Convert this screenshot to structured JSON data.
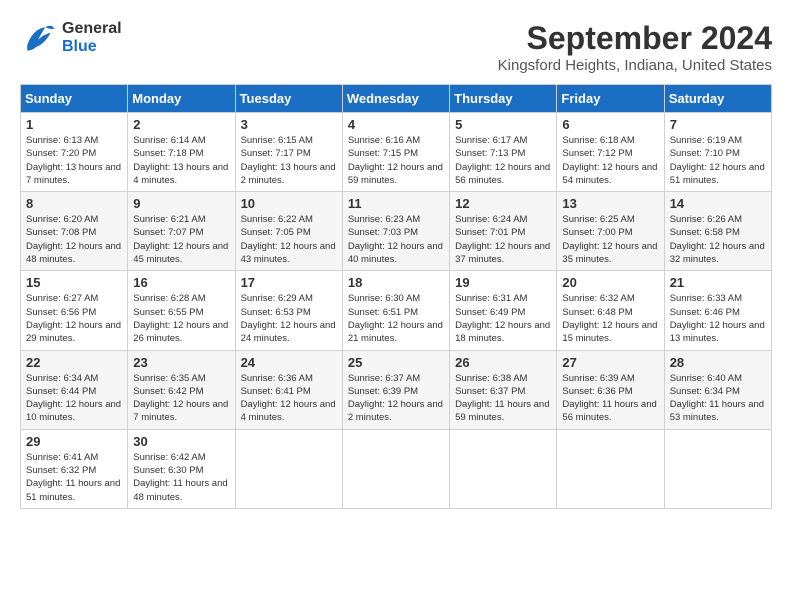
{
  "header": {
    "logo_line1": "General",
    "logo_line2": "Blue",
    "title": "September 2024",
    "subtitle": "Kingsford Heights, Indiana, United States"
  },
  "columns": [
    "Sunday",
    "Monday",
    "Tuesday",
    "Wednesday",
    "Thursday",
    "Friday",
    "Saturday"
  ],
  "weeks": [
    [
      {
        "day": "1",
        "sunrise": "Sunrise: 6:13 AM",
        "sunset": "Sunset: 7:20 PM",
        "daylight": "Daylight: 13 hours and 7 minutes."
      },
      {
        "day": "2",
        "sunrise": "Sunrise: 6:14 AM",
        "sunset": "Sunset: 7:18 PM",
        "daylight": "Daylight: 13 hours and 4 minutes."
      },
      {
        "day": "3",
        "sunrise": "Sunrise: 6:15 AM",
        "sunset": "Sunset: 7:17 PM",
        "daylight": "Daylight: 13 hours and 2 minutes."
      },
      {
        "day": "4",
        "sunrise": "Sunrise: 6:16 AM",
        "sunset": "Sunset: 7:15 PM",
        "daylight": "Daylight: 12 hours and 59 minutes."
      },
      {
        "day": "5",
        "sunrise": "Sunrise: 6:17 AM",
        "sunset": "Sunset: 7:13 PM",
        "daylight": "Daylight: 12 hours and 56 minutes."
      },
      {
        "day": "6",
        "sunrise": "Sunrise: 6:18 AM",
        "sunset": "Sunset: 7:12 PM",
        "daylight": "Daylight: 12 hours and 54 minutes."
      },
      {
        "day": "7",
        "sunrise": "Sunrise: 6:19 AM",
        "sunset": "Sunset: 7:10 PM",
        "daylight": "Daylight: 12 hours and 51 minutes."
      }
    ],
    [
      {
        "day": "8",
        "sunrise": "Sunrise: 6:20 AM",
        "sunset": "Sunset: 7:08 PM",
        "daylight": "Daylight: 12 hours and 48 minutes."
      },
      {
        "day": "9",
        "sunrise": "Sunrise: 6:21 AM",
        "sunset": "Sunset: 7:07 PM",
        "daylight": "Daylight: 12 hours and 45 minutes."
      },
      {
        "day": "10",
        "sunrise": "Sunrise: 6:22 AM",
        "sunset": "Sunset: 7:05 PM",
        "daylight": "Daylight: 12 hours and 43 minutes."
      },
      {
        "day": "11",
        "sunrise": "Sunrise: 6:23 AM",
        "sunset": "Sunset: 7:03 PM",
        "daylight": "Daylight: 12 hours and 40 minutes."
      },
      {
        "day": "12",
        "sunrise": "Sunrise: 6:24 AM",
        "sunset": "Sunset: 7:01 PM",
        "daylight": "Daylight: 12 hours and 37 minutes."
      },
      {
        "day": "13",
        "sunrise": "Sunrise: 6:25 AM",
        "sunset": "Sunset: 7:00 PM",
        "daylight": "Daylight: 12 hours and 35 minutes."
      },
      {
        "day": "14",
        "sunrise": "Sunrise: 6:26 AM",
        "sunset": "Sunset: 6:58 PM",
        "daylight": "Daylight: 12 hours and 32 minutes."
      }
    ],
    [
      {
        "day": "15",
        "sunrise": "Sunrise: 6:27 AM",
        "sunset": "Sunset: 6:56 PM",
        "daylight": "Daylight: 12 hours and 29 minutes."
      },
      {
        "day": "16",
        "sunrise": "Sunrise: 6:28 AM",
        "sunset": "Sunset: 6:55 PM",
        "daylight": "Daylight: 12 hours and 26 minutes."
      },
      {
        "day": "17",
        "sunrise": "Sunrise: 6:29 AM",
        "sunset": "Sunset: 6:53 PM",
        "daylight": "Daylight: 12 hours and 24 minutes."
      },
      {
        "day": "18",
        "sunrise": "Sunrise: 6:30 AM",
        "sunset": "Sunset: 6:51 PM",
        "daylight": "Daylight: 12 hours and 21 minutes."
      },
      {
        "day": "19",
        "sunrise": "Sunrise: 6:31 AM",
        "sunset": "Sunset: 6:49 PM",
        "daylight": "Daylight: 12 hours and 18 minutes."
      },
      {
        "day": "20",
        "sunrise": "Sunrise: 6:32 AM",
        "sunset": "Sunset: 6:48 PM",
        "daylight": "Daylight: 12 hours and 15 minutes."
      },
      {
        "day": "21",
        "sunrise": "Sunrise: 6:33 AM",
        "sunset": "Sunset: 6:46 PM",
        "daylight": "Daylight: 12 hours and 13 minutes."
      }
    ],
    [
      {
        "day": "22",
        "sunrise": "Sunrise: 6:34 AM",
        "sunset": "Sunset: 6:44 PM",
        "daylight": "Daylight: 12 hours and 10 minutes."
      },
      {
        "day": "23",
        "sunrise": "Sunrise: 6:35 AM",
        "sunset": "Sunset: 6:42 PM",
        "daylight": "Daylight: 12 hours and 7 minutes."
      },
      {
        "day": "24",
        "sunrise": "Sunrise: 6:36 AM",
        "sunset": "Sunset: 6:41 PM",
        "daylight": "Daylight: 12 hours and 4 minutes."
      },
      {
        "day": "25",
        "sunrise": "Sunrise: 6:37 AM",
        "sunset": "Sunset: 6:39 PM",
        "daylight": "Daylight: 12 hours and 2 minutes."
      },
      {
        "day": "26",
        "sunrise": "Sunrise: 6:38 AM",
        "sunset": "Sunset: 6:37 PM",
        "daylight": "Daylight: 11 hours and 59 minutes."
      },
      {
        "day": "27",
        "sunrise": "Sunrise: 6:39 AM",
        "sunset": "Sunset: 6:36 PM",
        "daylight": "Daylight: 11 hours and 56 minutes."
      },
      {
        "day": "28",
        "sunrise": "Sunrise: 6:40 AM",
        "sunset": "Sunset: 6:34 PM",
        "daylight": "Daylight: 11 hours and 53 minutes."
      }
    ],
    [
      {
        "day": "29",
        "sunrise": "Sunrise: 6:41 AM",
        "sunset": "Sunset: 6:32 PM",
        "daylight": "Daylight: 11 hours and 51 minutes."
      },
      {
        "day": "30",
        "sunrise": "Sunrise: 6:42 AM",
        "sunset": "Sunset: 6:30 PM",
        "daylight": "Daylight: 11 hours and 48 minutes."
      },
      null,
      null,
      null,
      null,
      null
    ]
  ]
}
